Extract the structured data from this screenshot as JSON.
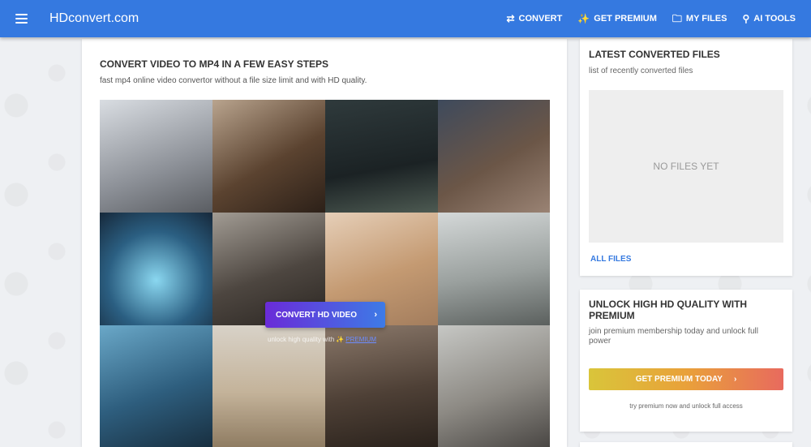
{
  "header": {
    "brand": "HDconvert.com",
    "nav": [
      {
        "label": "CONVERT",
        "icon": "⇄"
      },
      {
        "label": "GET PREMIUM",
        "icon": "✨"
      },
      {
        "label": "MY FILES",
        "icon": "🗀"
      },
      {
        "label": "AI TOOLS",
        "icon": "⚲"
      }
    ]
  },
  "main": {
    "title": "CONVERT VIDEO TO MP4 IN A FEW EASY STEPS",
    "subtitle": "fast mp4 online video convertor without a file size limit and with HD quality.",
    "convert_button": "CONVERT HD VIDEO",
    "unlock_note": "unlock high quality with",
    "premium_link": "PREMIUM"
  },
  "latest": {
    "title": "LATEST CONVERTED FILES",
    "subtitle": "list of recently converted files",
    "empty": "NO FILES YET",
    "all_files": "ALL FILES"
  },
  "unlock": {
    "title_line1": "UNLOCK HIGH HD QUALITY WITH",
    "title_line2": "PREMIUM",
    "sub_line1": "join premium membership today and unlock full",
    "sub_line2": "power",
    "button": "GET PREMIUM TODAY",
    "note": "try premium now and unlock full access"
  },
  "colors": {
    "header": "#3579e0",
    "accent_link": "#3579e0",
    "convert_gradient": [
      "#6a2bd8",
      "#3d7be6"
    ],
    "premium_gradient": [
      "#d9c53a",
      "#e9a13a",
      "#e86a5e"
    ]
  }
}
